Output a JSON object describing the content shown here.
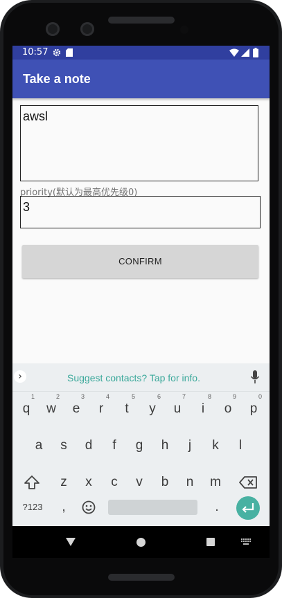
{
  "status": {
    "time": "10:57"
  },
  "appbar": {
    "title": "Take a note"
  },
  "form": {
    "note_value": "awsl",
    "priority_label": "priority(默认为最高优先级0)",
    "priority_value": "3",
    "confirm_label": "CONFIRM"
  },
  "keyboard": {
    "suggestion": "Suggest contacts? Tap for info.",
    "row1": [
      {
        "k": "q",
        "h": "1"
      },
      {
        "k": "w",
        "h": "2"
      },
      {
        "k": "e",
        "h": "3"
      },
      {
        "k": "r",
        "h": "4"
      },
      {
        "k": "t",
        "h": "5"
      },
      {
        "k": "y",
        "h": "6"
      },
      {
        "k": "u",
        "h": "7"
      },
      {
        "k": "i",
        "h": "8"
      },
      {
        "k": "o",
        "h": "9"
      },
      {
        "k": "p",
        "h": "0"
      }
    ],
    "row2": [
      "a",
      "s",
      "d",
      "f",
      "g",
      "h",
      "j",
      "k",
      "l"
    ],
    "row3": [
      "z",
      "x",
      "c",
      "v",
      "b",
      "n",
      "m"
    ],
    "symbols_label": "?123",
    "comma": ",",
    "period": "."
  },
  "colors": {
    "primary": "#3f51b5",
    "primary_dark": "#303f9f",
    "accent": "#48b1a2"
  },
  "icons": [
    "settings-icon",
    "sd-card-icon",
    "wifi-icon",
    "signal-icon",
    "battery-icon",
    "chevron-right-icon",
    "mic-icon",
    "shift-icon",
    "backspace-icon",
    "emoji-icon",
    "enter-icon",
    "back-icon",
    "home-icon",
    "recents-icon",
    "keyboard-icon"
  ]
}
